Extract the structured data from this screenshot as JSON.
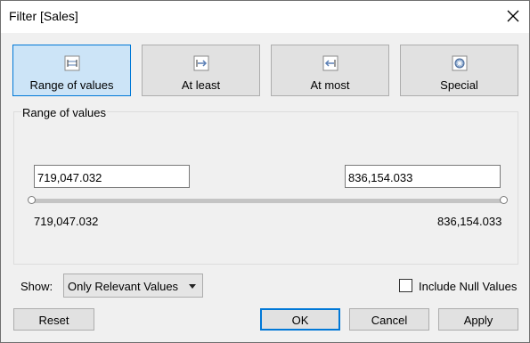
{
  "window": {
    "title": "Filter [Sales]"
  },
  "modes": [
    {
      "label": "Range of values",
      "icon": "range-of-values-icon",
      "active": true
    },
    {
      "label": "At least",
      "icon": "at-least-icon",
      "active": false
    },
    {
      "label": "At most",
      "icon": "at-most-icon",
      "active": false
    },
    {
      "label": "Special",
      "icon": "special-icon",
      "active": false
    }
  ],
  "range": {
    "group_title": "Range of values",
    "min_input": "719,047.032",
    "max_input": "836,154.033",
    "min_label": "719,047.032",
    "max_label": "836,154.033"
  },
  "show": {
    "label": "Show:",
    "selected": "Only Relevant Values"
  },
  "include_null": {
    "label": "Include Null Values",
    "checked": false
  },
  "footer": {
    "reset": "Reset",
    "ok": "OK",
    "cancel": "Cancel",
    "apply": "Apply"
  },
  "colors": {
    "active_mode_bg": "#cce4f7",
    "active_border": "#0078d7"
  }
}
